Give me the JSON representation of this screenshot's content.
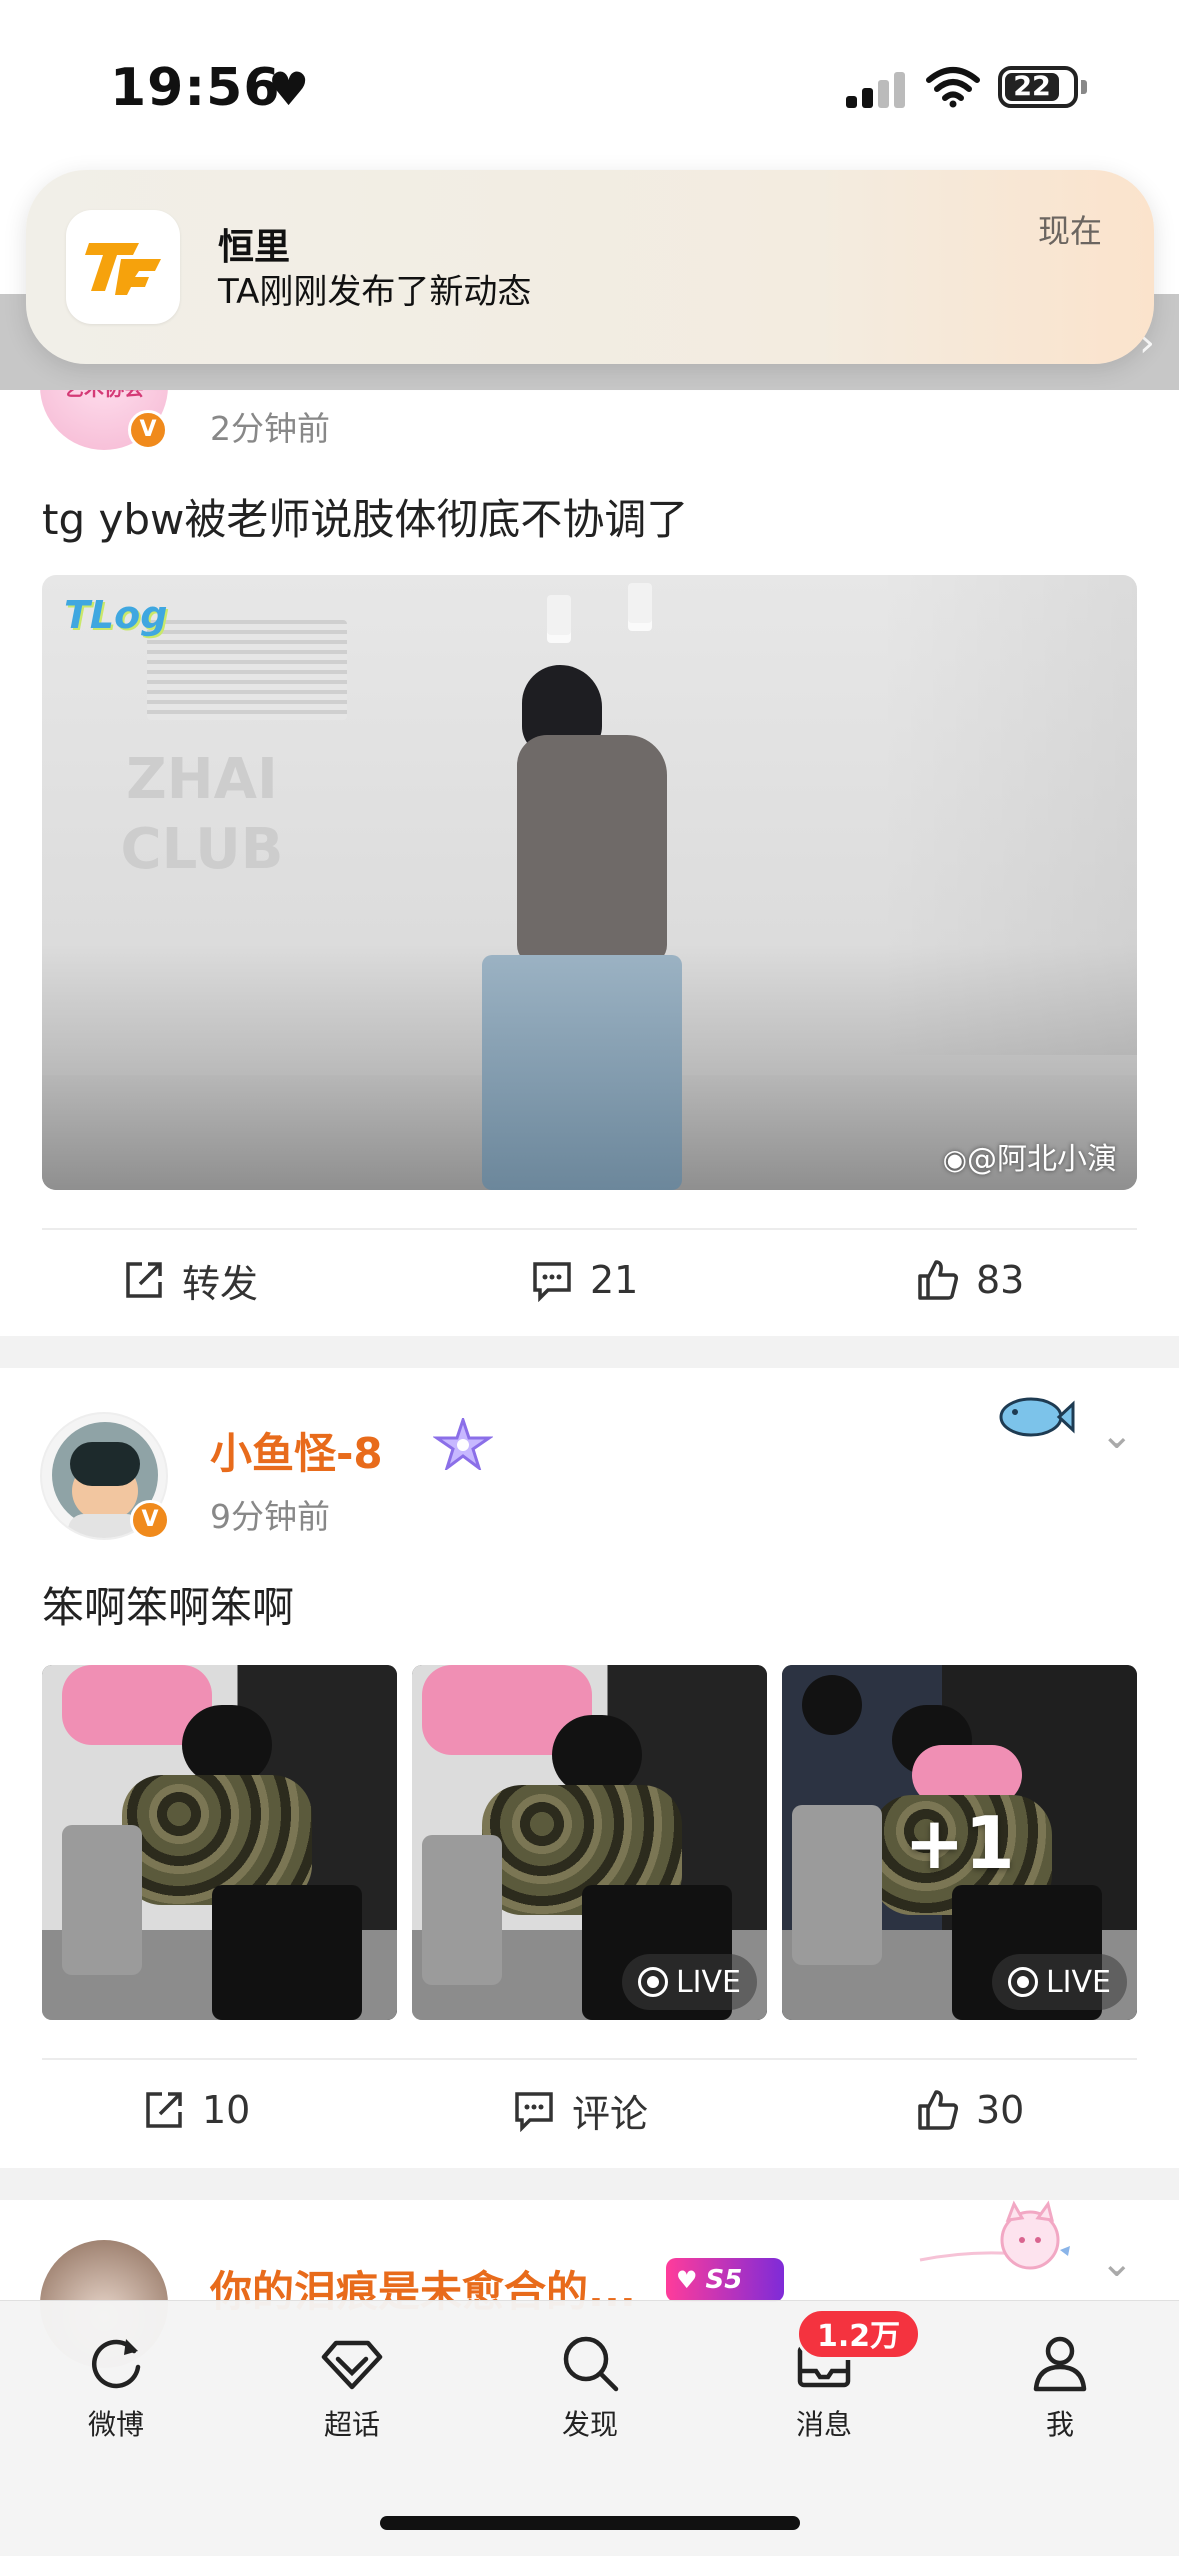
{
  "status_bar": {
    "time": "19:56",
    "battery": "22"
  },
  "notification": {
    "app_icon_name": "tf-app-icon",
    "title": "恒里",
    "body": "TA刚刚发布了新动态",
    "time": "现在"
  },
  "posts": [
    {
      "time": "2分钟前",
      "text": "tg ybw被老师说肢体彻底不协调了",
      "video": {
        "corner_logo": "TLog",
        "watermark": "@阿北小演"
      },
      "actions": {
        "repost": "转发",
        "comments": "21",
        "likes": "83"
      }
    },
    {
      "author": "小鱼怪-8",
      "time": "9分钟前",
      "text": "笨啊笨啊笨啊",
      "photos": [
        {
          "live": ""
        },
        {
          "live": "LIVE"
        },
        {
          "live": "LIVE",
          "more": "+1"
        }
      ],
      "actions": {
        "reposts": "10",
        "comment": "评论",
        "likes": "30"
      }
    },
    {
      "author": "你的泪痕是未愈合的...",
      "badge": "S5"
    }
  ],
  "tabbar": {
    "items": [
      {
        "label": "微博",
        "icon": "refresh-icon"
      },
      {
        "label": "超话",
        "icon": "diamond-icon"
      },
      {
        "label": "发现",
        "icon": "search-icon"
      },
      {
        "label": "消息",
        "icon": "mail-icon"
      },
      {
        "label": "我",
        "icon": "person-icon"
      }
    ],
    "message_badge": "1.2万"
  },
  "colors": {
    "accent_orange": "#e86b1b",
    "badge_red": "#f4333f",
    "vip_orange": "#f08a1c"
  }
}
